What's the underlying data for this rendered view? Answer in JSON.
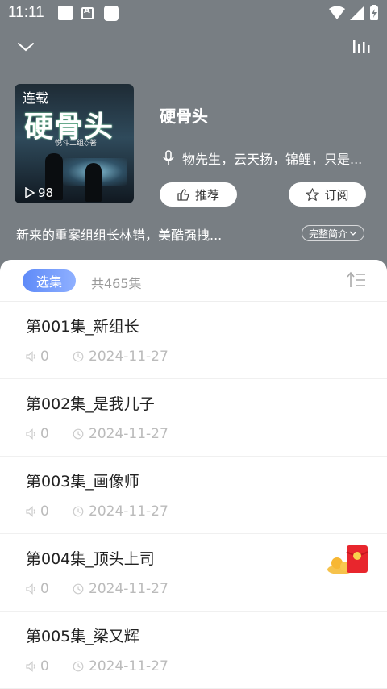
{
  "status": {
    "time": "11:11"
  },
  "album": {
    "cover_tag": "连载",
    "cover_title": "硬骨头",
    "cover_subtitle": "悦斗二组◇著",
    "plays": "98",
    "title": "硬骨头",
    "artists": "物先生，云天扬，锦鲤，只是...",
    "recommend_label": "推荐",
    "subscribe_label": "订阅",
    "description": "新来的重案组组长林错，美酷强拽...",
    "more_label": "完整简介"
  },
  "panel": {
    "active_tab": "选集",
    "count": "共465集"
  },
  "episodes": [
    {
      "name": "第001集_新组长",
      "plays": "0",
      "date": "2024-11-27"
    },
    {
      "name": "第002集_是我儿子",
      "plays": "0",
      "date": "2024-11-27"
    },
    {
      "name": "第003集_画像师",
      "plays": "0",
      "date": "2024-11-27"
    },
    {
      "name": "第004集_顶头上司",
      "plays": "0",
      "date": "2024-11-27"
    },
    {
      "name": "第005集_梁又辉",
      "plays": "0",
      "date": "2024-11-27"
    }
  ],
  "colors": {
    "accent": "#5e8af8",
    "header_bg": "#787e83"
  },
  "icons": [
    "chevron-down-icon",
    "equalizer-icon",
    "play-icon",
    "microphone-icon",
    "thumb-up-icon",
    "star-icon",
    "sort-icon",
    "speaker-icon",
    "clock-icon",
    "red-packet-icon"
  ]
}
